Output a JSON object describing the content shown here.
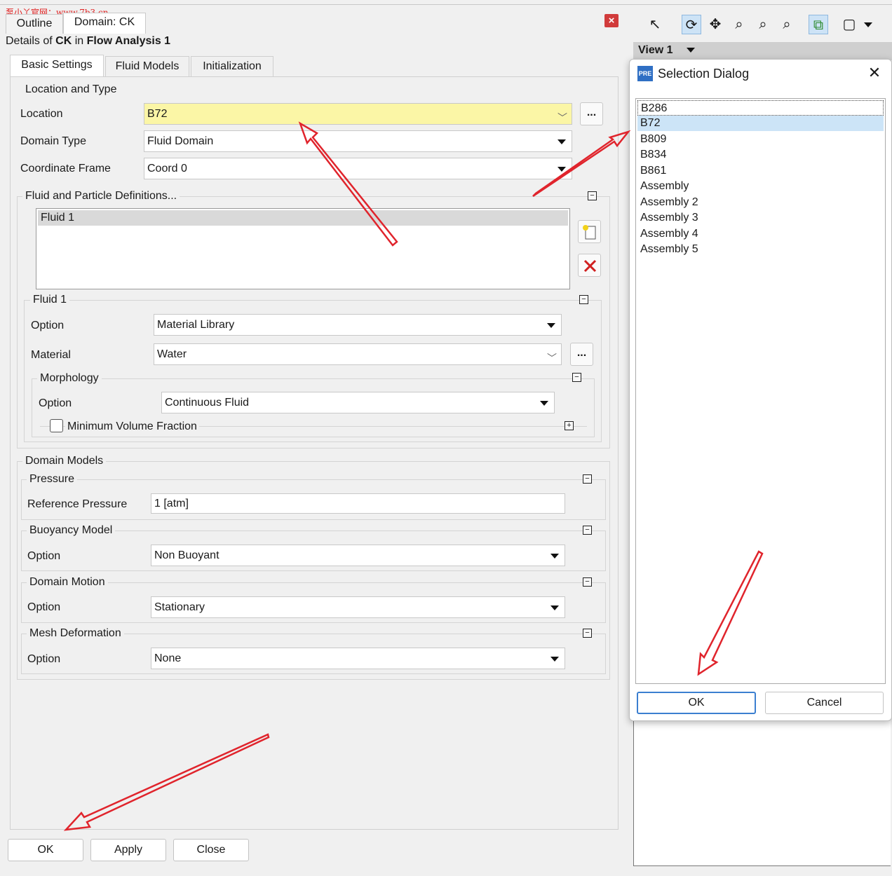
{
  "watermark": "泵小丫官网：www.7b3.cn",
  "panel": {
    "tabs": [
      "Outline",
      "Domain: CK"
    ],
    "details": {
      "prefix": "Details of",
      "name": "CK",
      "mid": "in",
      "analysis": "Flow Analysis 1"
    },
    "subtabs": [
      "Basic Settings",
      "Fluid Models",
      "Initialization"
    ]
  },
  "location_type": {
    "legend": "Location and Type",
    "location_label": "Location",
    "location_value": "B72",
    "domain_type_label": "Domain Type",
    "domain_type_value": "Fluid Domain",
    "coord_label": "Coordinate Frame",
    "coord_value": "Coord 0",
    "ellipsis": "..."
  },
  "fluid_defs": {
    "legend": "Fluid and Particle Definitions...",
    "items": [
      "Fluid 1"
    ]
  },
  "fluid1": {
    "legend": "Fluid 1",
    "option_label": "Option",
    "option_value": "Material Library",
    "material_label": "Material",
    "material_value": "Water",
    "morphology_legend": "Morphology",
    "morph_option_label": "Option",
    "morph_option_value": "Continuous Fluid",
    "min_vol_label": "Minimum Volume Fraction"
  },
  "domain_models": {
    "legend": "Domain Models",
    "pressure_legend": "Pressure",
    "ref_pressure_label": "Reference Pressure",
    "ref_pressure_value": "1 [atm]",
    "buoyancy_legend": "Buoyancy Model",
    "buoyancy_option_label": "Option",
    "buoyancy_option_value": "Non Buoyant",
    "motion_legend": "Domain Motion",
    "motion_option_label": "Option",
    "motion_option_value": "Stationary",
    "mesh_legend": "Mesh Deformation",
    "mesh_option_label": "Option",
    "mesh_option_value": "None"
  },
  "footer": {
    "ok": "OK",
    "apply": "Apply",
    "close": "Close"
  },
  "viewer": {
    "view_label": "View 1"
  },
  "selection_dialog": {
    "icon_text": "PRE",
    "title": "Selection Dialog",
    "items": [
      "B286",
      "B72",
      "B809",
      "B834",
      "B861",
      "Assembly",
      "Assembly 2",
      "Assembly 3",
      "Assembly 4",
      "Assembly 5"
    ],
    "selected": "B72",
    "ok": "OK",
    "cancel": "Cancel"
  },
  "colors": {
    "highlight_yellow": "#fbf6a6",
    "selection_blue": "#cce4f7",
    "annotation_red": "#e0242c",
    "close_red": "#d13b3b"
  }
}
